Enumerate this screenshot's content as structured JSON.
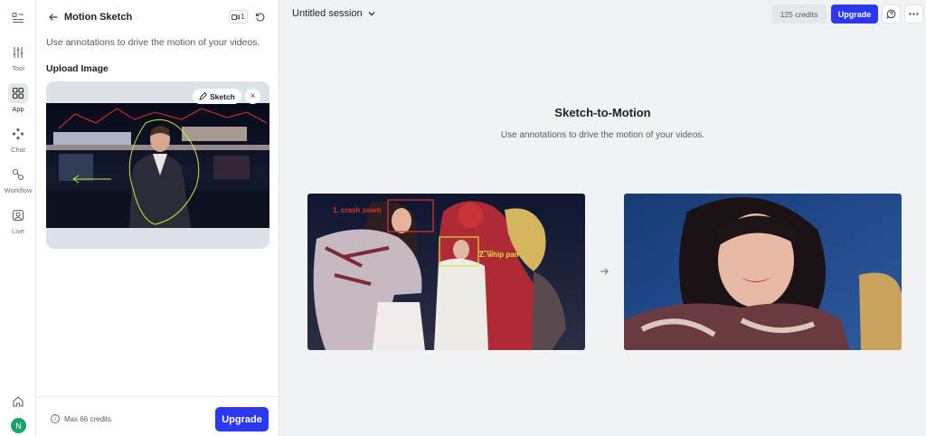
{
  "rail": {
    "items": [
      {
        "label": "Tool",
        "icon": "sliders-icon"
      },
      {
        "label": "App",
        "icon": "grid-icon",
        "active": true
      },
      {
        "label": "Chat",
        "icon": "nodes-icon"
      },
      {
        "label": "Workflow",
        "icon": "workflow-icon"
      },
      {
        "label": "Live",
        "icon": "portrait-icon"
      }
    ],
    "avatar_initial": "N"
  },
  "panel": {
    "title": "Motion Sketch",
    "camera_count": "1",
    "description": "Use annotations to drive the motion of your videos.",
    "upload_label": "Upload Image",
    "sketch_button": "Sketch",
    "close_glyph": "×",
    "info_glyph": "i",
    "max_credits": "Max 66 credits",
    "upgrade_label": "Upgrade"
  },
  "header": {
    "session_title": "Untitled session",
    "credits": "125 credits",
    "upgrade_label": "Upgrade"
  },
  "main": {
    "title": "Sketch-to-Motion",
    "subtitle": "Use annotations to drive the motion of your videos.",
    "annotations": [
      "1. crash zoom",
      "2. whip pan"
    ]
  },
  "colors": {
    "accent": "#2b37f0",
    "annotation_red": "#e0332b",
    "annotation_yellow": "#cfe33a",
    "avatar": "#17a36b"
  }
}
